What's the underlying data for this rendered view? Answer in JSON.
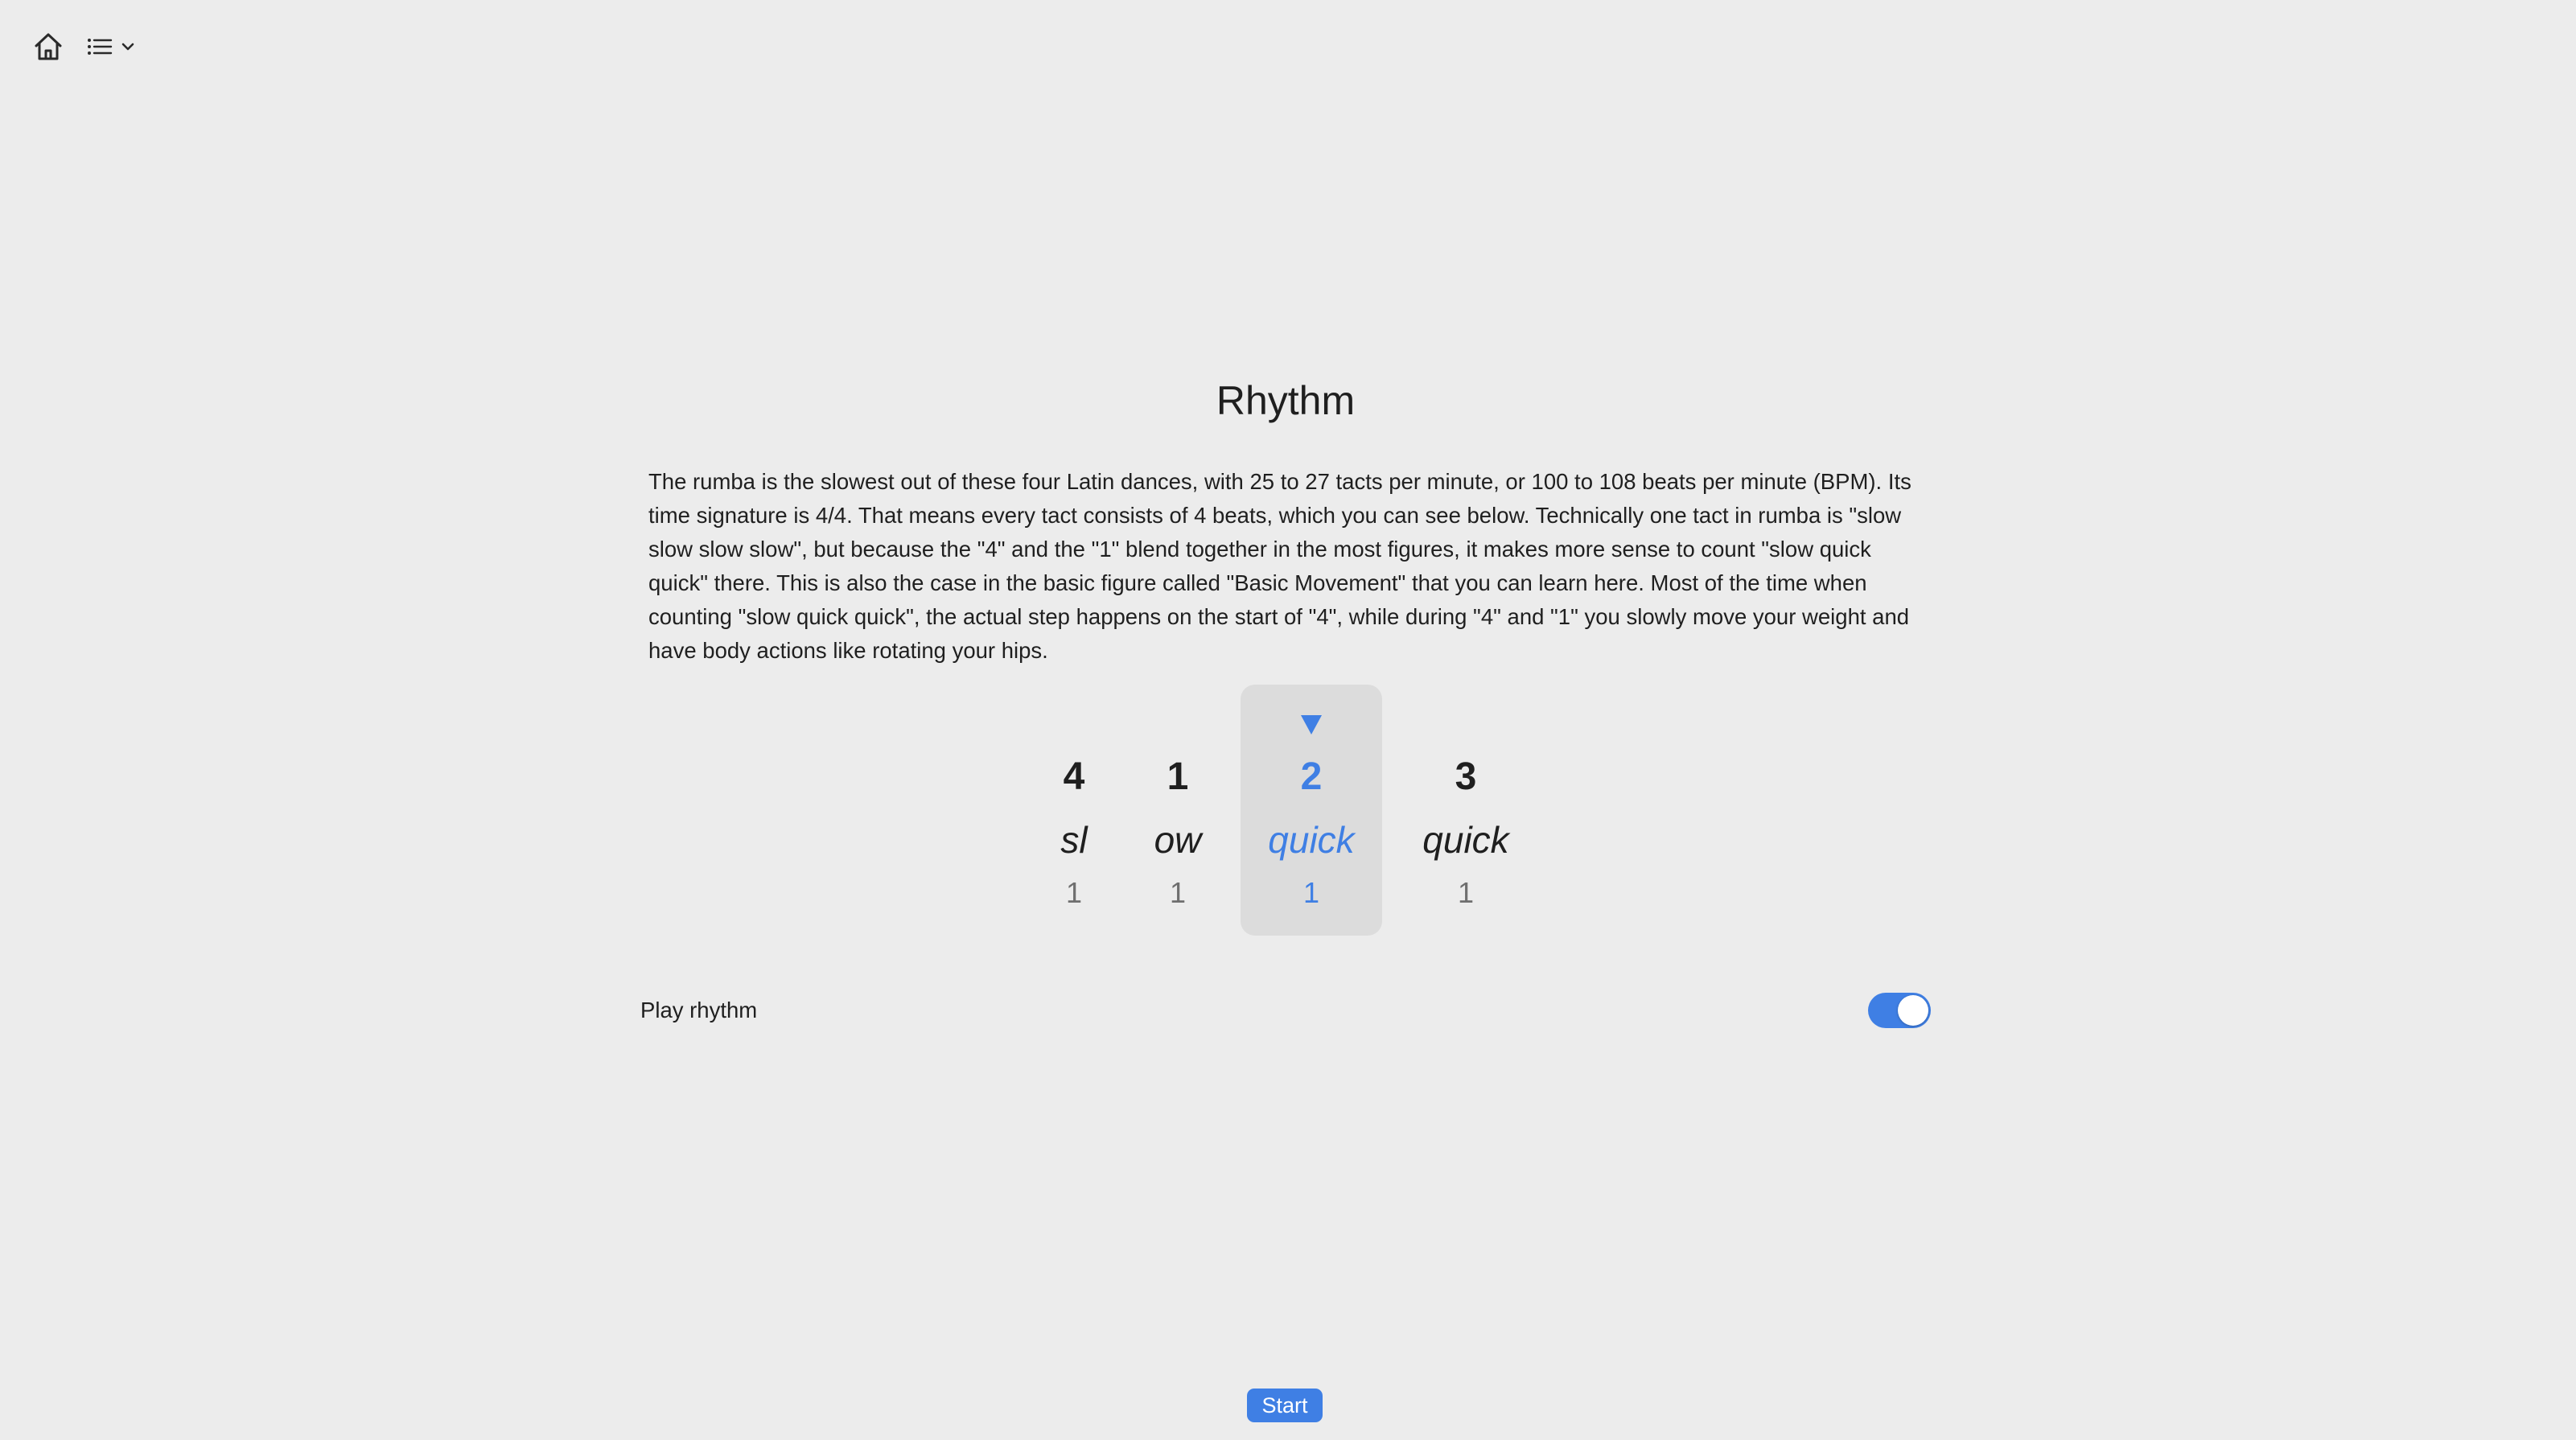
{
  "toolbar": {
    "home_icon": "home-icon",
    "menu_icon": "list-icon",
    "menu_chevron_icon": "chevron-down-icon"
  },
  "main": {
    "title": "Rhythm",
    "description": "The rumba is the slowest out of these four Latin dances, with 25 to 27 tacts per minute, or 100 to 108 beats per minute (BPM). Its time signature is 4/4. That means every tact consists of 4 beats, which you can see below. Technically one tact in rumba is \"slow slow slow slow\", but because the \"4\" and the \"1\" blend together in the most figures, it makes more sense to count \"slow quick quick\" there. This is also the case in the basic figure called \"Basic Movement\" that you can learn here. Most of the time when counting \"slow quick quick\", the actual step happens on the start of \"4\", while during \"4\" and \"1\" you slowly move your weight and have body actions like rotating your hips."
  },
  "beats": [
    {
      "number": "4",
      "word": "sl",
      "count": "1",
      "active": false
    },
    {
      "number": "1",
      "word": "ow",
      "count": "1",
      "active": false
    },
    {
      "number": "2",
      "word": "quick",
      "count": "1",
      "active": true
    },
    {
      "number": "3",
      "word": "quick",
      "count": "1",
      "active": false
    }
  ],
  "play_rhythm": {
    "label": "Play rhythm",
    "enabled": true
  },
  "start_button": {
    "label": "Start"
  },
  "colors": {
    "accent": "#3f7fe4",
    "background": "#ececec",
    "active_beat_bg": "#dcdcdc"
  }
}
